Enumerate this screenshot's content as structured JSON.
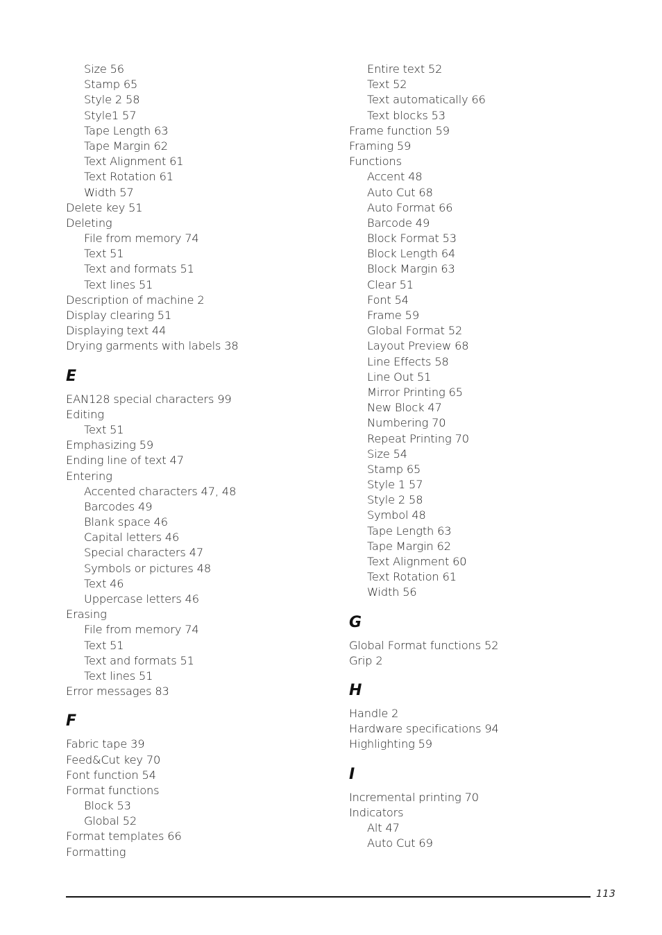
{
  "left_column": [
    {
      "type": "entry",
      "level": 1,
      "text": "Size 56"
    },
    {
      "type": "entry",
      "level": 1,
      "text": "Stamp 65"
    },
    {
      "type": "entry",
      "level": 1,
      "text": "Style 2 58"
    },
    {
      "type": "entry",
      "level": 1,
      "text": "Style1 57"
    },
    {
      "type": "entry",
      "level": 1,
      "text": "Tape Length 63"
    },
    {
      "type": "entry",
      "level": 1,
      "text": "Tape Margin 62"
    },
    {
      "type": "entry",
      "level": 1,
      "text": "Text Alignment 61"
    },
    {
      "type": "entry",
      "level": 1,
      "text": "Text Rotation 61"
    },
    {
      "type": "entry",
      "level": 1,
      "text": "Width 57"
    },
    {
      "type": "entry",
      "level": 0,
      "text": "Delete key 51"
    },
    {
      "type": "entry",
      "level": 0,
      "text": "Deleting"
    },
    {
      "type": "entry",
      "level": 1,
      "text": "File from memory 74"
    },
    {
      "type": "entry",
      "level": 1,
      "text": "Text 51"
    },
    {
      "type": "entry",
      "level": 1,
      "text": "Text and formats 51"
    },
    {
      "type": "entry",
      "level": 1,
      "text": "Text lines 51"
    },
    {
      "type": "entry",
      "level": 0,
      "text": "Description of machine 2"
    },
    {
      "type": "entry",
      "level": 0,
      "text": "Display clearing 51"
    },
    {
      "type": "entry",
      "level": 0,
      "text": "Displaying text 44"
    },
    {
      "type": "entry",
      "level": 0,
      "text": "Drying garments with labels 38"
    },
    {
      "type": "letter",
      "text": "E"
    },
    {
      "type": "entry",
      "level": 0,
      "text": "EAN128 special characters 99"
    },
    {
      "type": "entry",
      "level": 0,
      "text": "Editing"
    },
    {
      "type": "entry",
      "level": 1,
      "text": "Text 51"
    },
    {
      "type": "entry",
      "level": 0,
      "text": "Emphasizing 59"
    },
    {
      "type": "entry",
      "level": 0,
      "text": "Ending line of text 47"
    },
    {
      "type": "entry",
      "level": 0,
      "text": "Entering"
    },
    {
      "type": "entry",
      "level": 1,
      "text": "Accented characters 47, 48"
    },
    {
      "type": "entry",
      "level": 1,
      "text": "Barcodes 49"
    },
    {
      "type": "entry",
      "level": 1,
      "text": "Blank space 46"
    },
    {
      "type": "entry",
      "level": 1,
      "text": "Capital letters 46"
    },
    {
      "type": "entry",
      "level": 1,
      "text": "Special characters 47"
    },
    {
      "type": "entry",
      "level": 1,
      "text": "Symbols or pictures 48"
    },
    {
      "type": "entry",
      "level": 1,
      "text": "Text 46"
    },
    {
      "type": "entry",
      "level": 1,
      "text": "Uppercase letters 46"
    },
    {
      "type": "entry",
      "level": 0,
      "text": "Erasing"
    },
    {
      "type": "entry",
      "level": 1,
      "text": "File from memory 74"
    },
    {
      "type": "entry",
      "level": 1,
      "text": "Text 51"
    },
    {
      "type": "entry",
      "level": 1,
      "text": "Text and formats 51"
    },
    {
      "type": "entry",
      "level": 1,
      "text": "Text lines 51"
    },
    {
      "type": "entry",
      "level": 0,
      "text": "Error messages 83"
    },
    {
      "type": "letter",
      "text": "F"
    },
    {
      "type": "entry",
      "level": 0,
      "text": "Fabric tape 39"
    },
    {
      "type": "entry",
      "level": 0,
      "text": "Feed&Cut key 70"
    },
    {
      "type": "entry",
      "level": 0,
      "text": "Font function 54"
    },
    {
      "type": "entry",
      "level": 0,
      "text": "Format functions"
    },
    {
      "type": "entry",
      "level": 1,
      "text": "Block 53"
    },
    {
      "type": "entry",
      "level": 1,
      "text": "Global 52"
    },
    {
      "type": "entry",
      "level": 0,
      "text": "Format templates 66"
    },
    {
      "type": "entry",
      "level": 0,
      "text": "Formatting"
    }
  ],
  "right_column": [
    {
      "type": "entry",
      "level": 1,
      "text": "Entire text 52"
    },
    {
      "type": "entry",
      "level": 1,
      "text": "Text 52"
    },
    {
      "type": "entry",
      "level": 1,
      "text": "Text automatically 66"
    },
    {
      "type": "entry",
      "level": 1,
      "text": "Text blocks 53"
    },
    {
      "type": "entry",
      "level": 0,
      "text": "Frame function 59"
    },
    {
      "type": "entry",
      "level": 0,
      "text": "Framing 59"
    },
    {
      "type": "entry",
      "level": 0,
      "text": "Functions"
    },
    {
      "type": "entry",
      "level": 1,
      "text": "Accent 48"
    },
    {
      "type": "entry",
      "level": 1,
      "text": "Auto Cut 68"
    },
    {
      "type": "entry",
      "level": 1,
      "text": "Auto Format 66"
    },
    {
      "type": "entry",
      "level": 1,
      "text": "Barcode 49"
    },
    {
      "type": "entry",
      "level": 1,
      "text": "Block Format 53"
    },
    {
      "type": "entry",
      "level": 1,
      "text": "Block Length 64"
    },
    {
      "type": "entry",
      "level": 1,
      "text": "Block Margin 63"
    },
    {
      "type": "entry",
      "level": 1,
      "text": "Clear 51"
    },
    {
      "type": "entry",
      "level": 1,
      "text": "Font 54"
    },
    {
      "type": "entry",
      "level": 1,
      "text": "Frame 59"
    },
    {
      "type": "entry",
      "level": 1,
      "text": "Global Format 52"
    },
    {
      "type": "entry",
      "level": 1,
      "text": "Layout Preview 68"
    },
    {
      "type": "entry",
      "level": 1,
      "text": "Line Effects 58"
    },
    {
      "type": "entry",
      "level": 1,
      "text": "Line Out 51"
    },
    {
      "type": "entry",
      "level": 1,
      "text": "Mirror Printing 65"
    },
    {
      "type": "entry",
      "level": 1,
      "text": "New Block 47"
    },
    {
      "type": "entry",
      "level": 1,
      "text": "Numbering 70"
    },
    {
      "type": "entry",
      "level": 1,
      "text": "Repeat Printing 70"
    },
    {
      "type": "entry",
      "level": 1,
      "text": "Size 54"
    },
    {
      "type": "entry",
      "level": 1,
      "text": "Stamp 65"
    },
    {
      "type": "entry",
      "level": 1,
      "text": "Style 1 57"
    },
    {
      "type": "entry",
      "level": 1,
      "text": "Style 2 58"
    },
    {
      "type": "entry",
      "level": 1,
      "text": "Symbol 48"
    },
    {
      "type": "entry",
      "level": 1,
      "text": "Tape Length 63"
    },
    {
      "type": "entry",
      "level": 1,
      "text": "Tape Margin 62"
    },
    {
      "type": "entry",
      "level": 1,
      "text": "Text Alignment 60"
    },
    {
      "type": "entry",
      "level": 1,
      "text": "Text Rotation 61"
    },
    {
      "type": "entry",
      "level": 1,
      "text": "Width 56"
    },
    {
      "type": "letter",
      "text": "G"
    },
    {
      "type": "entry",
      "level": 0,
      "text": "Global Format functions 52"
    },
    {
      "type": "entry",
      "level": 0,
      "text": "Grip 2"
    },
    {
      "type": "letter",
      "text": "H"
    },
    {
      "type": "entry",
      "level": 0,
      "text": "Handle 2"
    },
    {
      "type": "entry",
      "level": 0,
      "text": "Hardware specifications 94"
    },
    {
      "type": "entry",
      "level": 0,
      "text": "Highlighting 59"
    },
    {
      "type": "letter",
      "text": "I"
    },
    {
      "type": "entry",
      "level": 0,
      "text": "Incremental printing 70"
    },
    {
      "type": "entry",
      "level": 0,
      "text": "Indicators"
    },
    {
      "type": "entry",
      "level": 1,
      "text": "Alt 47"
    },
    {
      "type": "entry",
      "level": 1,
      "text": "Auto Cut 69"
    }
  ],
  "footer": {
    "page_number": "113"
  }
}
